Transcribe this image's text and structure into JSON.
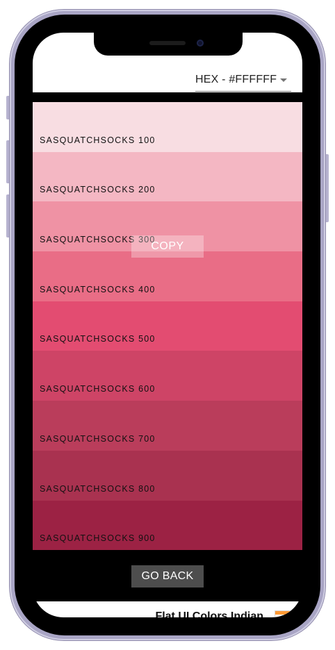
{
  "format_select": {
    "value": "HEX - #FFFFFF"
  },
  "swatches": [
    {
      "label": "SASQUATCHSOCKS 100",
      "color": "#f8dde2"
    },
    {
      "label": "SASQUATCHSOCKS 200",
      "color": "#f4b7c3"
    },
    {
      "label": "SASQUATCHSOCKS 300",
      "color": "#ef92a4"
    },
    {
      "label": "SASQUATCHSOCKS 400",
      "color": "#e96d86"
    },
    {
      "label": "SASQUATCHSOCKS 500",
      "color": "#e34c71"
    },
    {
      "label": "SASQUATCHSOCKS 600",
      "color": "#ce4466"
    },
    {
      "label": "SASQUATCHSOCKS 700",
      "color": "#ba3d5b"
    },
    {
      "label": "SASQUATCHSOCKS 800",
      "color": "#a93250"
    },
    {
      "label": "SASQUATCHSOCKS 900",
      "color": "#9c2244"
    }
  ],
  "copy_button": {
    "label": "COPY"
  },
  "go_back_button": {
    "label": "GO BACK"
  },
  "footer": {
    "title": "Flat UI Colors Indian",
    "flag_icon": "india-flag-icon",
    "flag_colors": [
      "#ff9933",
      "#ffffff",
      "#138808"
    ]
  },
  "colors": {
    "phone_frame": "#a9a5c5",
    "screen_background": "#000000",
    "button_background": "#4d4d4d"
  }
}
